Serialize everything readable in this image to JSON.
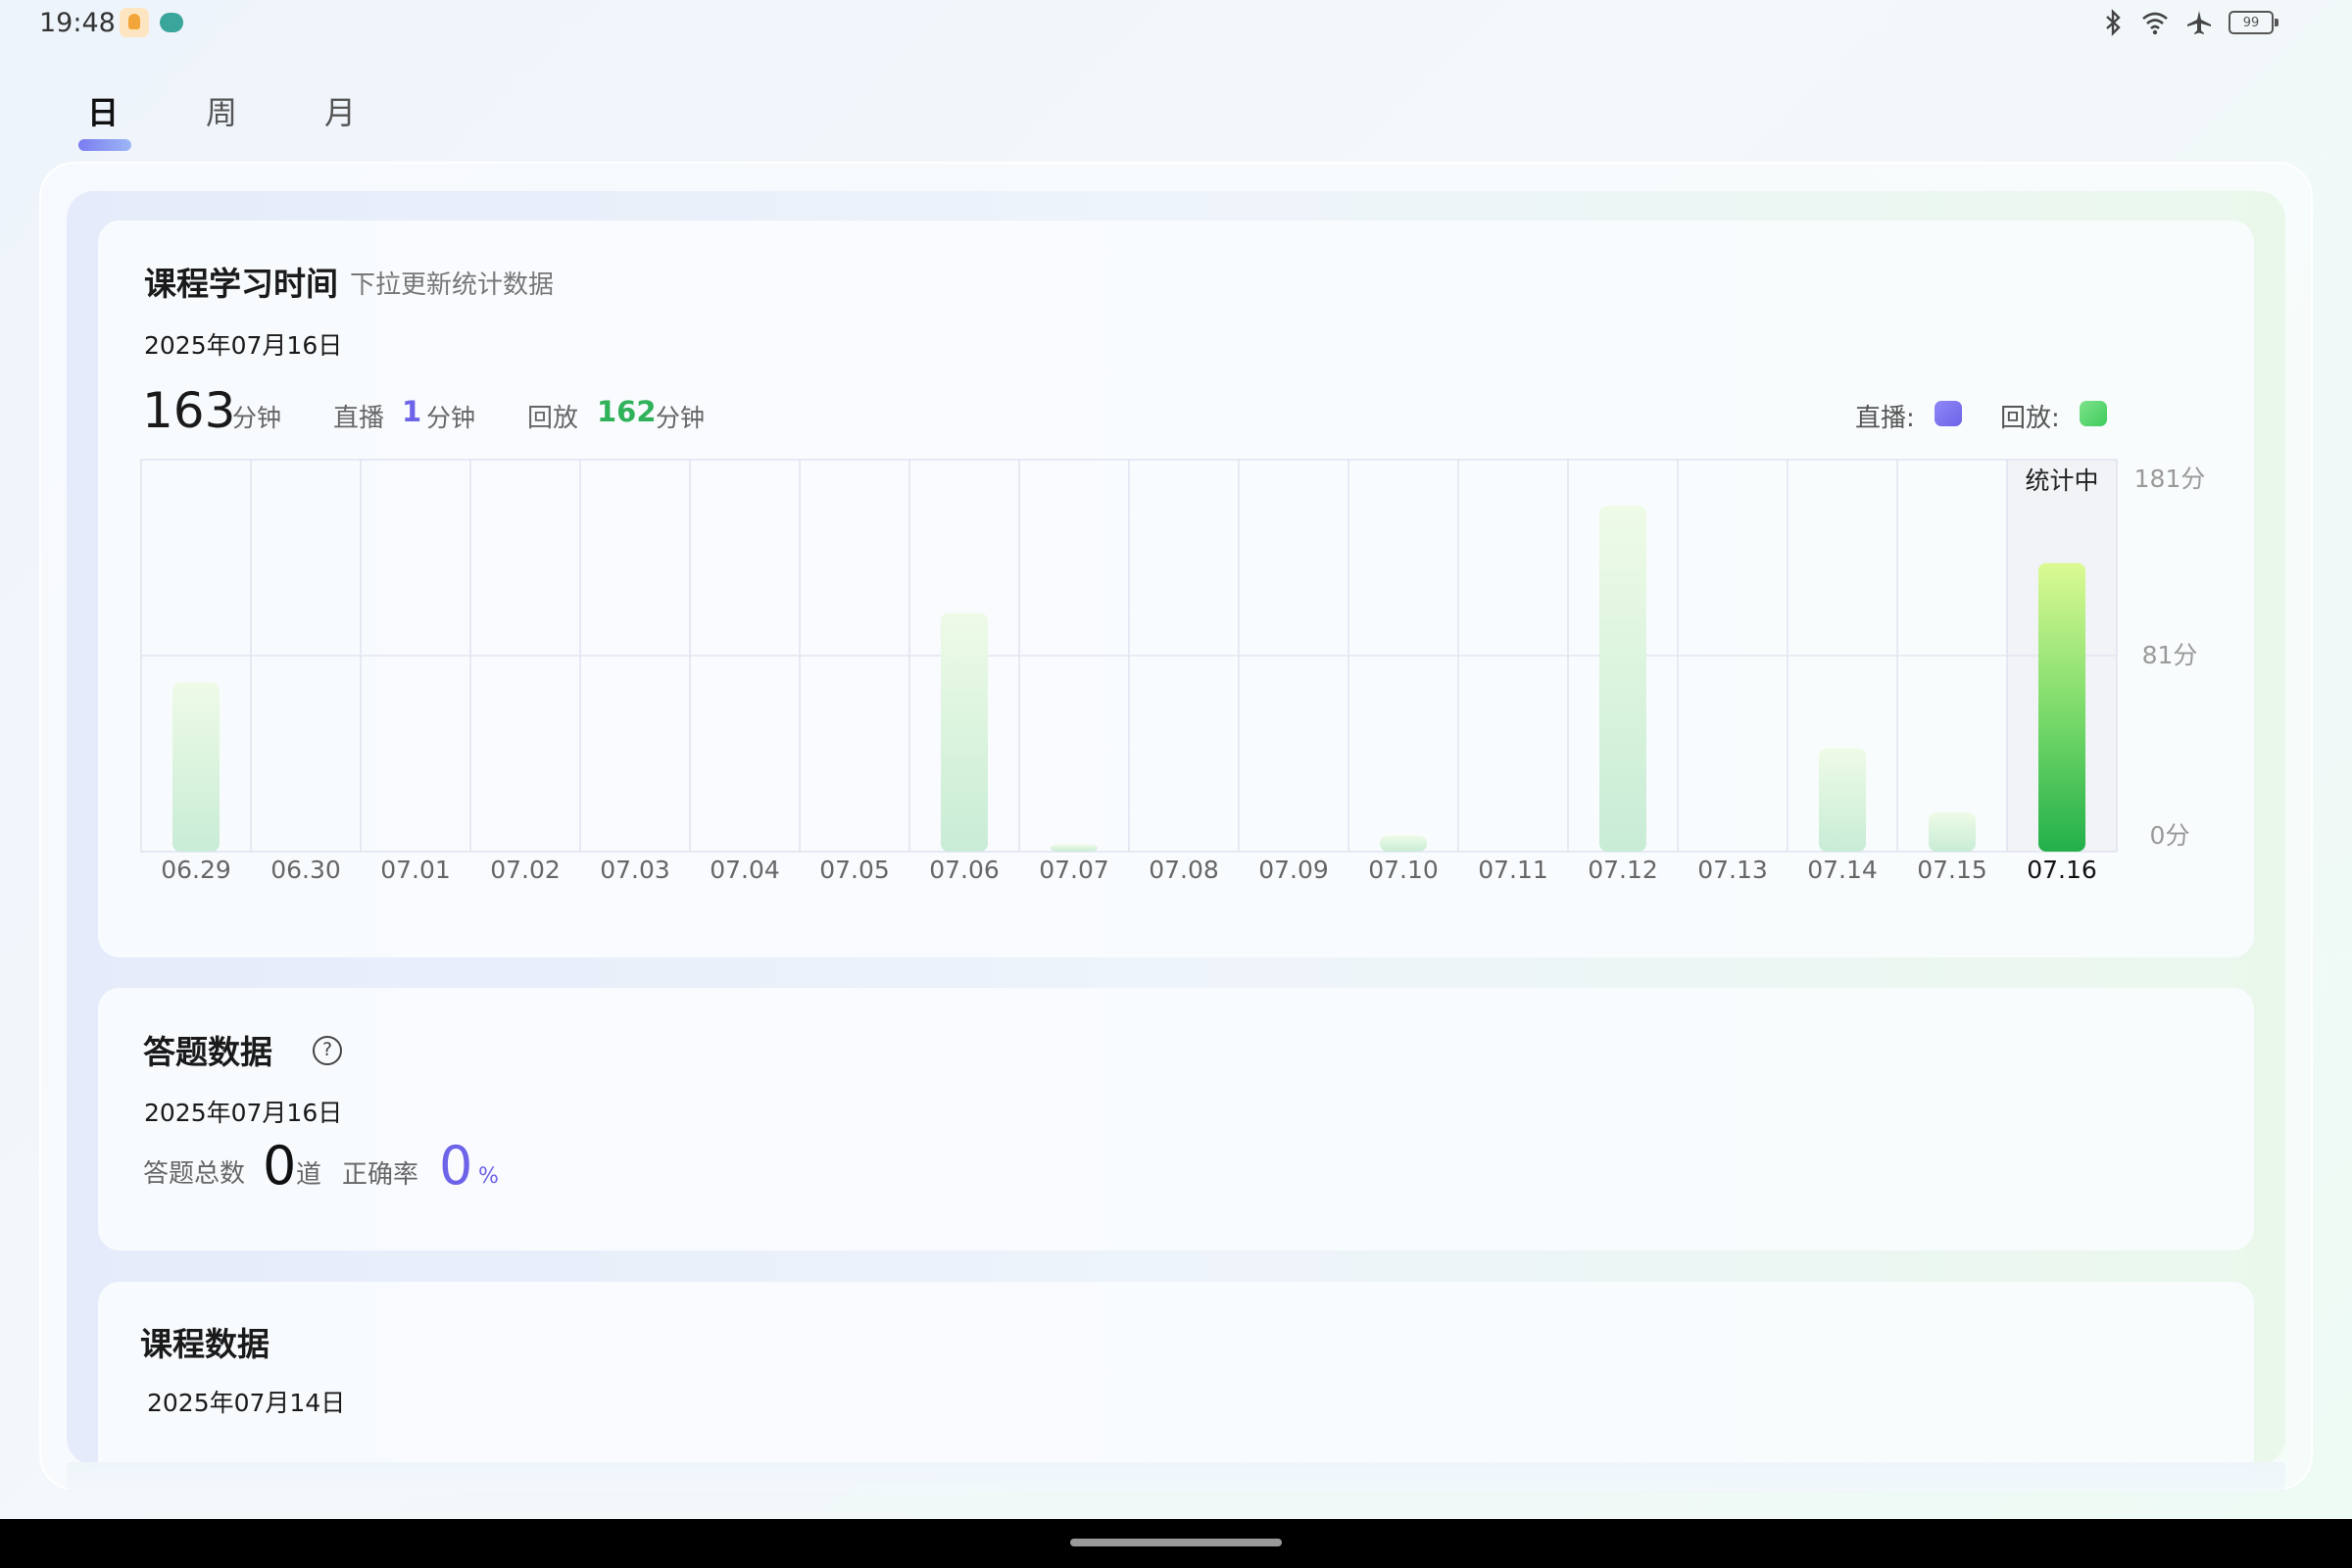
{
  "status_bar": {
    "time": "19:48",
    "battery": "99",
    "icons": [
      "app-icon-1",
      "app-icon-2",
      "bluetooth-icon",
      "wifi-icon",
      "airplane-icon",
      "battery-icon"
    ]
  },
  "tabs": [
    {
      "label": "日",
      "active": true
    },
    {
      "label": "周",
      "active": false
    },
    {
      "label": "月",
      "active": false
    }
  ],
  "study_time": {
    "title": "课程学习时间",
    "subtitle": "下拉更新统计数据",
    "date": "2025年07月16日",
    "total": "163",
    "total_unit": "分钟",
    "live_label": "直播",
    "live_value": "1",
    "live_unit": "分钟",
    "playback_label": "回放",
    "playback_value": "162",
    "playback_unit": "分钟",
    "legend_live": "直播:",
    "legend_playback": "回放:",
    "colors": {
      "live": "#7b74ee",
      "playback": "#4fd66a",
      "accent_purple": "#6c63e8",
      "accent_green": "#2fb259"
    }
  },
  "chart_data": {
    "type": "bar",
    "categories": [
      "06.29",
      "06.30",
      "07.01",
      "07.02",
      "07.03",
      "07.04",
      "07.05",
      "07.06",
      "07.07",
      "07.08",
      "07.09",
      "07.10",
      "07.11",
      "07.12",
      "07.13",
      "07.14",
      "07.15",
      "07.16"
    ],
    "series": [
      {
        "values": [
          0,
          0,
          0,
          0,
          0,
          0,
          0,
          0,
          0,
          0,
          0,
          0,
          0,
          0,
          0,
          0,
          0,
          1
        ]
      },
      {
        "values": [
          95,
          0,
          0,
          0,
          0,
          0,
          0,
          134,
          4,
          0,
          0,
          9,
          0,
          194,
          0,
          58,
          22,
          162
        ]
      }
    ],
    "highlight_index": 17,
    "highlight_label": "统计中",
    "y_ticks": [
      "181分",
      "81分",
      "0分"
    ],
    "ylim": [
      0,
      220
    ],
    "grid": true,
    "legend": "top-right"
  },
  "answers": {
    "title": "答题数据",
    "help_icon": "question-circle-icon",
    "help_glyph": "?",
    "date": "2025年07月16日",
    "total_label": "答题总数",
    "total_value": "0",
    "total_unit": "道",
    "accuracy_label": "正确率",
    "accuracy_value": "0",
    "accuracy_unit": "%"
  },
  "course": {
    "title": "课程数据",
    "date": "2025年07月14日"
  }
}
